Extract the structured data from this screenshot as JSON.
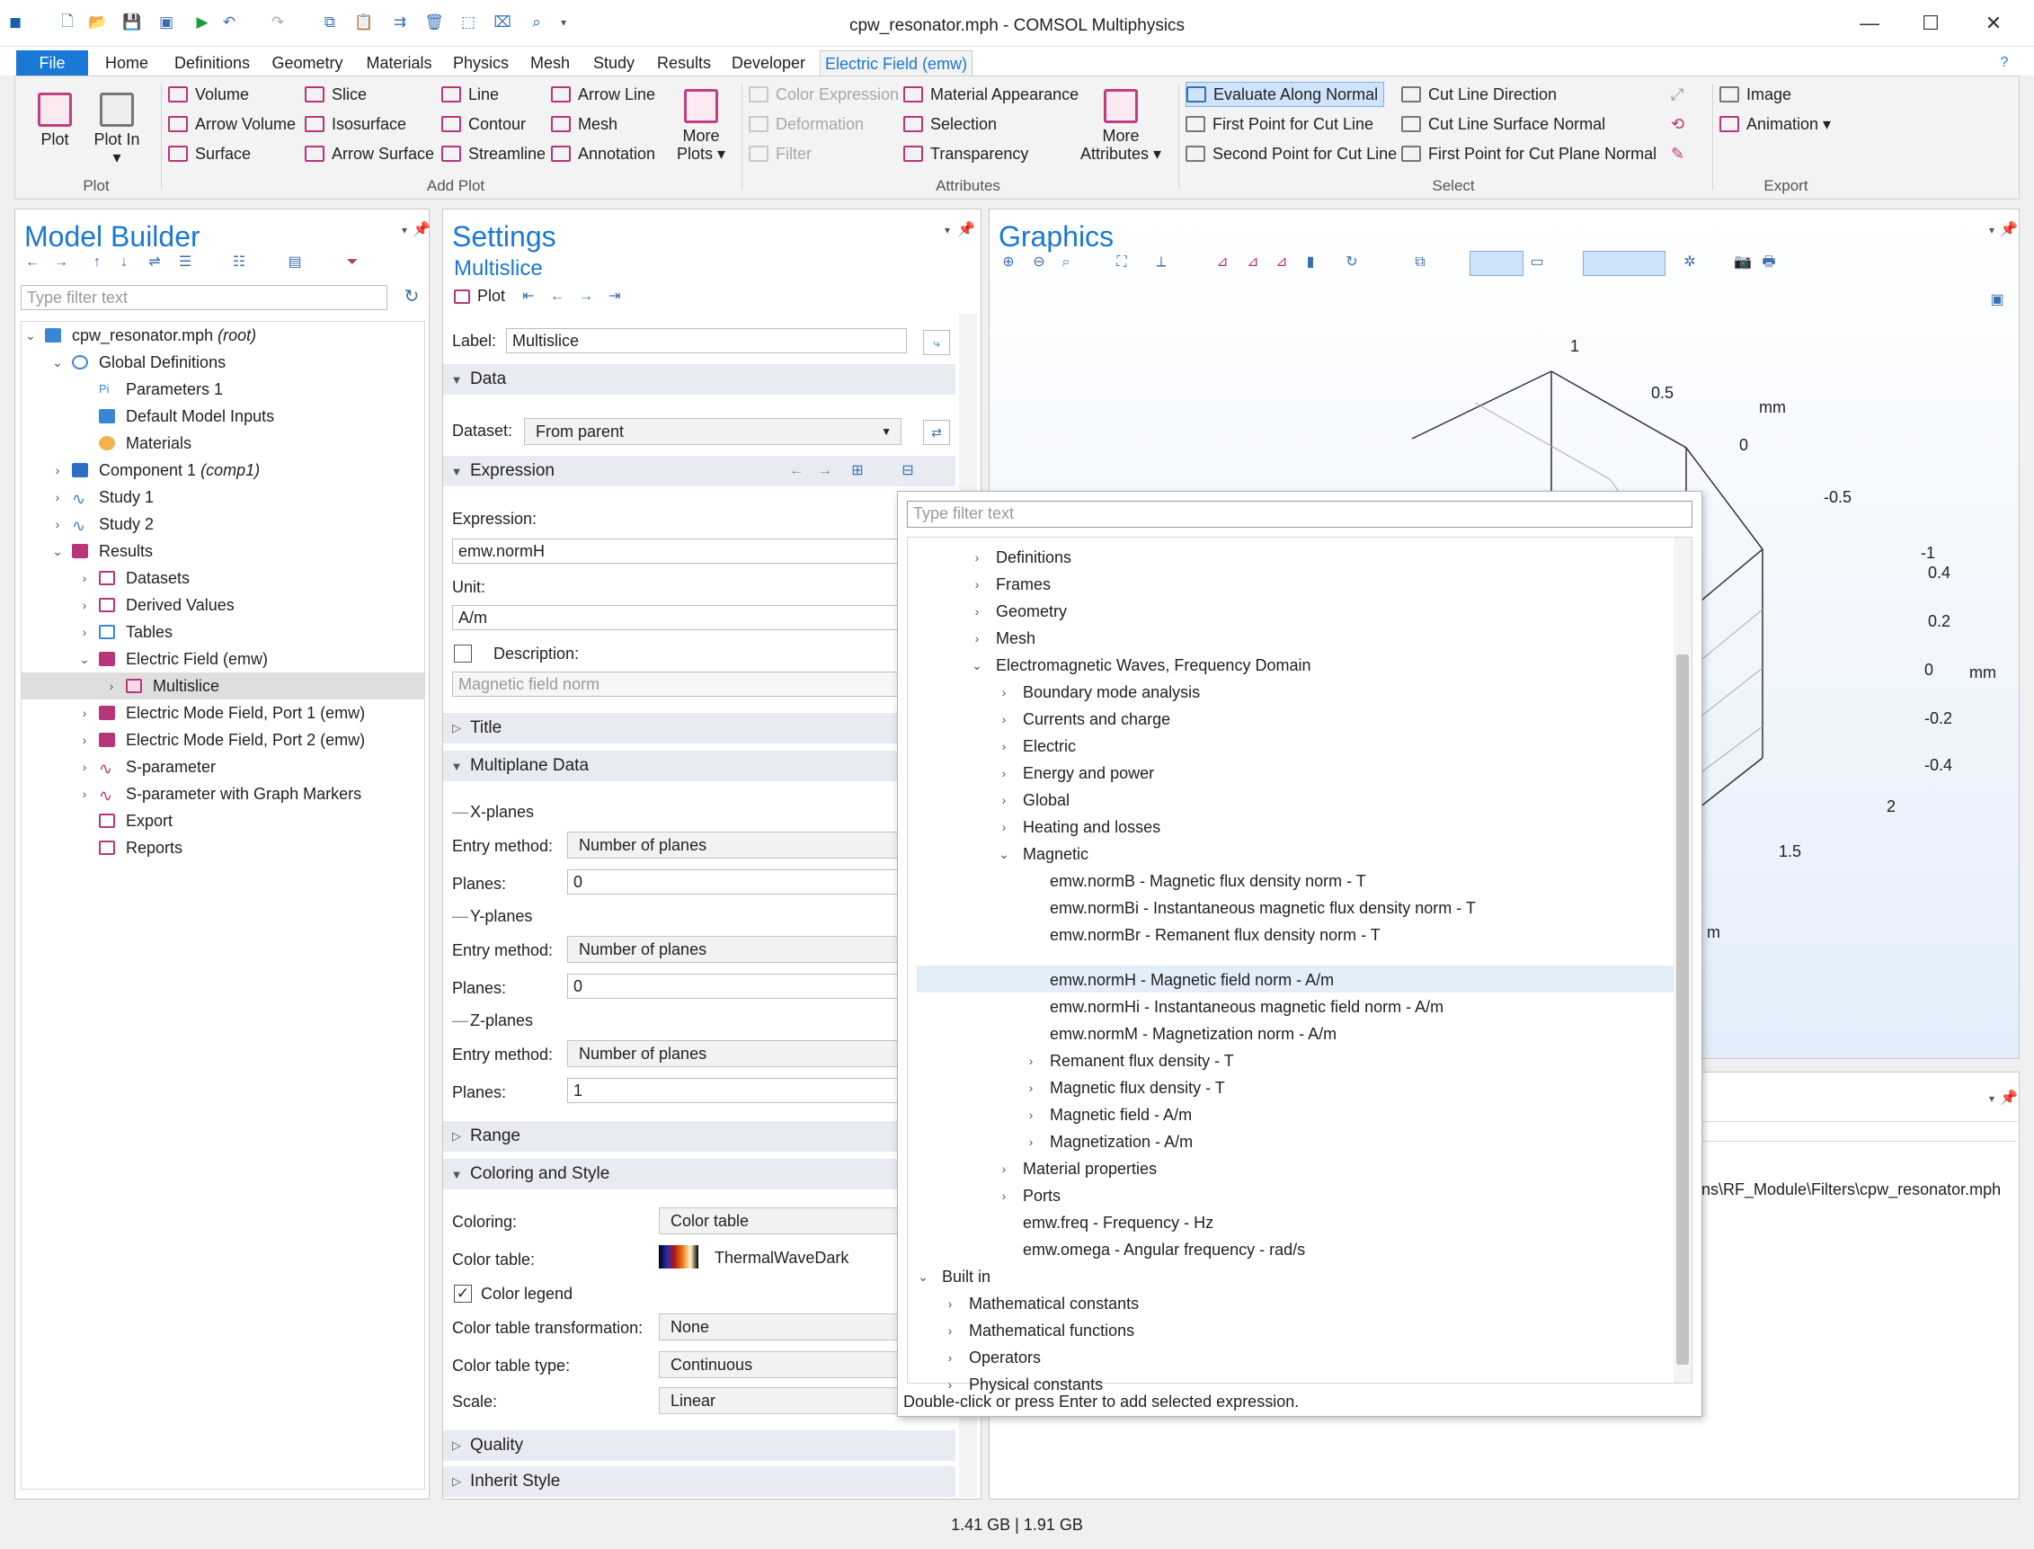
{
  "window": {
    "title": "cpw_resonator.mph - COMSOL Multiphysics"
  },
  "menu": {
    "file": "File",
    "tabs": [
      "Home",
      "Definitions",
      "Geometry",
      "Materials",
      "Physics",
      "Mesh",
      "Study",
      "Results",
      "Developer"
    ],
    "contextual": "Electric Field (emw)"
  },
  "ribbon": {
    "plot": {
      "plot": "Plot",
      "plot_in": "Plot In ▾",
      "group": "Plot"
    },
    "add_plot": {
      "c1": [
        "Volume",
        "Arrow Volume",
        "Surface"
      ],
      "c2": [
        "Slice",
        "Isosurface",
        "Arrow Surface"
      ],
      "c3": [
        "Line",
        "Contour",
        "Streamline"
      ],
      "c4": [
        "Arrow Line",
        "Mesh",
        "Annotation"
      ],
      "more": "More Plots ▾",
      "group": "Add Plot"
    },
    "attributes": {
      "c1": [
        "Color Expression",
        "Deformation",
        "Filter"
      ],
      "c2": [
        "Material Appearance",
        "Selection",
        "Transparency"
      ],
      "more": "More Attributes ▾",
      "group": "Attributes"
    },
    "select": {
      "c1": [
        "Evaluate Along Normal",
        "First Point for Cut Line",
        "Second Point for Cut Line"
      ],
      "c2": [
        "Cut Line Direction",
        "Cut Line Surface Normal",
        "First Point for Cut Plane Normal"
      ],
      "group": "Select"
    },
    "export": {
      "items": [
        "Image",
        "Animation ▾"
      ],
      "group": "Export"
    }
  },
  "model_builder": {
    "title": "Model Builder",
    "filter_placeholder": "Type filter text",
    "tree": [
      {
        "label": "cpw_resonator.mph",
        "suffix": "(root)"
      },
      {
        "label": "Global Definitions"
      },
      {
        "label": "Parameters 1"
      },
      {
        "label": "Default Model Inputs"
      },
      {
        "label": "Materials"
      },
      {
        "label": "Component 1",
        "suffix": "(comp1)"
      },
      {
        "label": "Study 1"
      },
      {
        "label": "Study 2"
      },
      {
        "label": "Results"
      },
      {
        "label": "Datasets"
      },
      {
        "label": "Derived Values"
      },
      {
        "label": "Tables"
      },
      {
        "label": "Electric Field (emw)"
      },
      {
        "label": "Multislice"
      },
      {
        "label": "Electric Mode Field, Port 1 (emw)"
      },
      {
        "label": "Electric Mode Field, Port 2 (emw)"
      },
      {
        "label": "S-parameter"
      },
      {
        "label": "S-parameter with Graph Markers"
      },
      {
        "label": "Export"
      },
      {
        "label": "Reports"
      }
    ]
  },
  "settings": {
    "title": "Settings",
    "subtitle": "Multislice",
    "plot_btn": "Plot",
    "label_lbl": "Label:",
    "label_val": "Multislice",
    "data": "Data",
    "dataset_lbl": "Dataset:",
    "dataset_val": "From parent",
    "expression": "Expression",
    "expr_lbl": "Expression:",
    "expr_val": "emw.normH",
    "unit_lbl": "Unit:",
    "unit_val": "A/m",
    "desc_lbl": "Description:",
    "desc_val": "Magnetic field norm",
    "title_sec": "Title",
    "multiplane": "Multiplane Data",
    "xplanes": "X-planes",
    "yplanes": "Y-planes",
    "zplanes": "Z-planes",
    "entry_lbl": "Entry method:",
    "entry_val": "Number of planes",
    "planes_lbl": "Planes:",
    "x_planes": "0",
    "y_planes": "0",
    "z_planes": "1",
    "range": "Range",
    "coloring_style": "Coloring and Style",
    "coloring_lbl": "Coloring:",
    "coloring_val": "Color table",
    "ctable_lbl": "Color table:",
    "ctable_val": "ThermalWaveDark",
    "legend_lbl": "Color legend",
    "ctt_lbl": "Color table transformation:",
    "ctt_val": "None",
    "cttype_lbl": "Color table type:",
    "cttype_val": "Continuous",
    "scale_lbl": "Scale:",
    "scale_val": "Linear",
    "quality": "Quality",
    "inherit": "Inherit Style"
  },
  "graphics": {
    "title": "Graphics",
    "axis_labels": [
      "1",
      "0.5",
      "mm",
      "0",
      "-0.5",
      "-1",
      "0.4",
      "0.2",
      "0",
      "mm",
      "-0.2",
      "-0.4",
      "2",
      "1.5",
      "m"
    ]
  },
  "messages": {
    "path": "ns\\RF_Module\\Filters\\cpw_resonator.mph"
  },
  "popup": {
    "filter_placeholder": "Type filter text",
    "rows": [
      "Definitions",
      "Frames",
      "Geometry",
      "Mesh",
      "Electromagnetic Waves, Frequency Domain",
      "Boundary mode analysis",
      "Currents and charge",
      "Electric",
      "Energy and power",
      "Global",
      "Heating and losses",
      "Magnetic",
      "emw.normB - Magnetic flux density norm - T",
      "emw.normBi - Instantaneous magnetic flux density norm - T",
      "emw.normBr - Remanent flux density norm - T",
      "emw.normH - Magnetic field norm - A/m",
      "emw.normHi - Instantaneous magnetic field norm - A/m",
      "emw.normM - Magnetization norm - A/m",
      "Remanent flux density - T",
      "Magnetic flux density - T",
      "Magnetic field - A/m",
      "Magnetization - A/m",
      "Material properties",
      "Ports",
      "emw.freq - Frequency - Hz",
      "emw.omega - Angular frequency - rad/s",
      "Built in",
      "Mathematical constants",
      "Mathematical functions",
      "Operators",
      "Physical constants"
    ],
    "hint": "Double-click or press Enter to add selected expression."
  },
  "status": {
    "memory": "1.41 GB | 1.91 GB"
  },
  "colors": {
    "accent": "#1a78d6",
    "ribbon_icon": "#b9357a",
    "selected": "#dedede",
    "highlight": "#e3eef9"
  }
}
